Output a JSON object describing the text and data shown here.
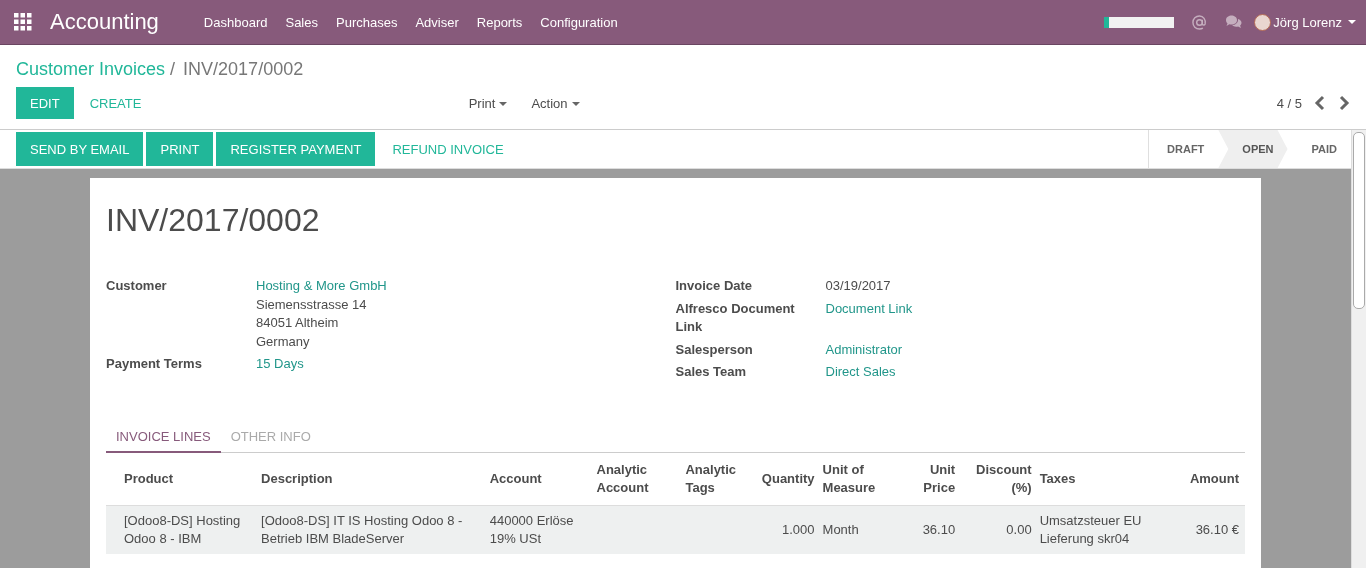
{
  "app_title": "Accounting",
  "menu": [
    "Dashboard",
    "Sales",
    "Purchases",
    "Adviser",
    "Reports",
    "Configuration"
  ],
  "user": {
    "name": "Jörg Lorenz"
  },
  "breadcrumb": {
    "parent": "Customer Invoices",
    "separator": "/",
    "current": "INV/2017/0002"
  },
  "main_buttons": [
    {
      "label": "EDIT",
      "kind": "primary"
    },
    {
      "label": "CREATE",
      "kind": "link"
    }
  ],
  "dropdowns": [
    "Print",
    "Action"
  ],
  "pager": {
    "text": "4 / 5"
  },
  "header_buttons": [
    {
      "label": "SEND BY EMAIL",
      "kind": "primary"
    },
    {
      "label": "PRINT",
      "kind": "primary"
    },
    {
      "label": "REGISTER PAYMENT",
      "kind": "primary"
    },
    {
      "label": "REFUND INVOICE",
      "kind": "link"
    }
  ],
  "statuses": [
    {
      "label": "DRAFT",
      "selected": false
    },
    {
      "label": "OPEN",
      "selected": true
    },
    {
      "label": "PAID",
      "selected": false
    }
  ],
  "title": "INV/2017/0002",
  "left_fields": [
    {
      "label": "Customer",
      "values": [
        {
          "text": "Hosting & More GmbH",
          "kind": "link"
        },
        {
          "text": "Siemensstrasse 14",
          "kind": "text"
        },
        {
          "text": "84051 Altheim",
          "kind": "text"
        },
        {
          "text": "Germany",
          "kind": "text"
        }
      ]
    },
    {
      "label": "Payment Terms",
      "values": [
        {
          "text": "15 Days",
          "kind": "link"
        }
      ]
    }
  ],
  "right_fields": [
    {
      "label": "Invoice Date",
      "values": [
        {
          "text": "03/19/2017",
          "kind": "text"
        }
      ]
    },
    {
      "label": "Alfresco Document Link",
      "values": [
        {
          "text": "Document Link",
          "kind": "link"
        }
      ]
    },
    {
      "label": "Salesperson",
      "values": [
        {
          "text": "Administrator",
          "kind": "link"
        }
      ]
    },
    {
      "label": "Sales Team",
      "values": [
        {
          "text": "Direct Sales",
          "kind": "link"
        }
      ]
    }
  ],
  "tabs": [
    {
      "label": "INVOICE LINES",
      "selected": true
    },
    {
      "label": "OTHER INFO",
      "selected": false
    }
  ],
  "table": {
    "columns": [
      {
        "label": "Product",
        "kind": "text"
      },
      {
        "label": "Description",
        "kind": "text"
      },
      {
        "label": "Account",
        "kind": "text"
      },
      {
        "label": "Analytic Account",
        "kind": "text"
      },
      {
        "label": "Analytic Tags",
        "kind": "text"
      },
      {
        "label": "Quantity",
        "kind": "number"
      },
      {
        "label": "Unit of Measure",
        "kind": "text"
      },
      {
        "label": "Unit Price",
        "kind": "number"
      },
      {
        "label": "Discount (%)",
        "kind": "number"
      },
      {
        "label": "Taxes",
        "kind": "text"
      },
      {
        "label": "Amount",
        "kind": "number"
      }
    ],
    "rows": [
      [
        "[Odoo8-DS] Hosting Odoo 8 - IBM",
        "[Odoo8-DS] IT IS Hosting Odoo 8 - Betrieb IBM BladeServer",
        "440000 Erlöse 19% USt",
        "",
        "",
        "1.000",
        "Month",
        "36.10",
        "0.00",
        "Umsatzsteuer EU Lieferung skr04",
        "36.10 €"
      ]
    ]
  }
}
